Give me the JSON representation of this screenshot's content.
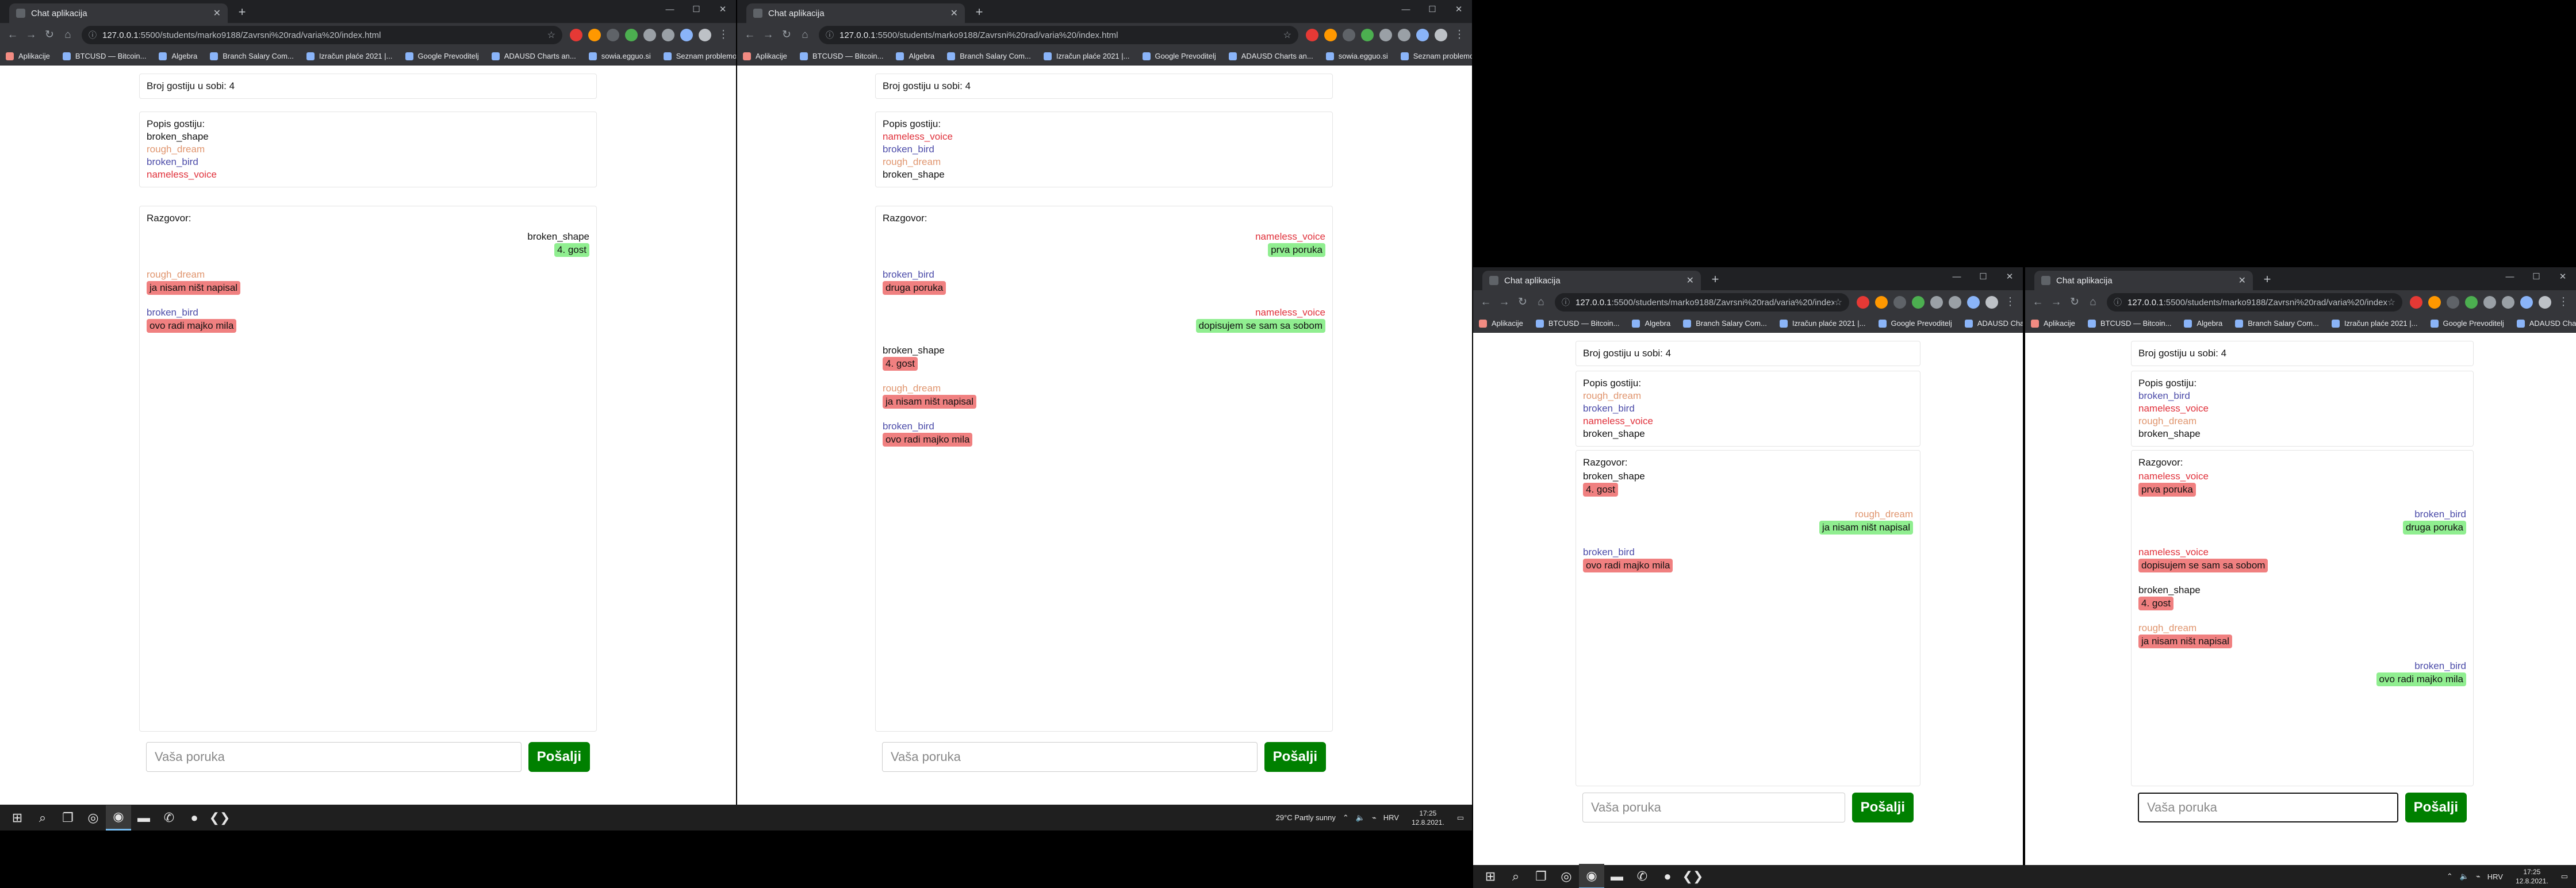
{
  "browser": {
    "tab_title": "Chat aplikacija",
    "url_host": "127.0.0.1",
    "url_rest": ":5500/students/marko9188/Zavrsni%20rad/varia%20/index.html",
    "bookmarks": [
      "Aplikacije",
      "BTCUSD — Bitcoin...",
      "Algebra",
      "Branch Salary Com...",
      "Izračun plaće 2021 |...",
      "Google Prevoditelj",
      "ADAUSD Charts an...",
      "sowia.egguo.si",
      "Seznam problemov..."
    ],
    "bookmarks_short": [
      "Aplikacije",
      "BTCUSD — Bitcoin...",
      "Algebra",
      "Branch Salary Com...",
      "Izračun plaće 2021 |...",
      "Google Prevoditelj",
      "ADAUSD Charts an..."
    ]
  },
  "labels": {
    "guest_count": "Broj gostiju u sobi: 4",
    "guest_list_title": "Popis gostiju:",
    "chat_title": "Razgovor:",
    "input_placeholder": "Vaša poruka",
    "send": "Pošalji"
  },
  "colors": {
    "broken_shape": "#111111",
    "rough_dream": "#e0956e",
    "broken_bird": "#4a4aa8",
    "nameless_voice": "#e0303a",
    "own_bubble": "#90ee90",
    "other_bubble": "#f08080",
    "send_button": "#008000"
  },
  "windows": [
    {
      "id": "w1",
      "guests": [
        {
          "name": "broken_shape",
          "color": "#111111"
        },
        {
          "name": "rough_dream",
          "color": "#e0956e"
        },
        {
          "name": "broken_bird",
          "color": "#4a4aa8"
        },
        {
          "name": "nameless_voice",
          "color": "#e0303a"
        }
      ],
      "messages": [
        {
          "user": "broken_shape",
          "text": "4. gost",
          "own": true,
          "color": "#111111"
        },
        {
          "user": "rough_dream",
          "text": "ja nisam ništ napisal",
          "own": false,
          "color": "#e0956e"
        },
        {
          "user": "broken_bird",
          "text": "ovo radi majko mila",
          "own": false,
          "color": "#4a4aa8"
        }
      ]
    },
    {
      "id": "w2",
      "guests": [
        {
          "name": "nameless_voice",
          "color": "#e0303a"
        },
        {
          "name": "broken_bird",
          "color": "#4a4aa8"
        },
        {
          "name": "rough_dream",
          "color": "#e0956e"
        },
        {
          "name": "broken_shape",
          "color": "#111111"
        }
      ],
      "messages": [
        {
          "user": "nameless_voice",
          "text": "prva poruka",
          "own": true,
          "color": "#e0303a"
        },
        {
          "user": "broken_bird",
          "text": "druga poruka",
          "own": false,
          "color": "#4a4aa8"
        },
        {
          "user": "nameless_voice",
          "text": "dopisujem se sam sa sobom",
          "own": true,
          "color": "#e0303a"
        },
        {
          "user": "broken_shape",
          "text": "4. gost",
          "own": false,
          "color": "#111111"
        },
        {
          "user": "rough_dream",
          "text": "ja nisam ništ napisal",
          "own": false,
          "color": "#e0956e"
        },
        {
          "user": "broken_bird",
          "text": "ovo radi majko mila",
          "own": false,
          "color": "#4a4aa8"
        }
      ]
    },
    {
      "id": "w3",
      "guests": [
        {
          "name": "rough_dream",
          "color": "#e0956e"
        },
        {
          "name": "broken_bird",
          "color": "#4a4aa8"
        },
        {
          "name": "nameless_voice",
          "color": "#e0303a"
        },
        {
          "name": "broken_shape",
          "color": "#111111"
        }
      ],
      "messages": [
        {
          "user": "broken_shape",
          "text": "4. gost",
          "own": false,
          "color": "#111111"
        },
        {
          "user": "rough_dream",
          "text": "ja nisam ništ napisal",
          "own": true,
          "color": "#e0956e"
        },
        {
          "user": "broken_bird",
          "text": "ovo radi majko mila",
          "own": false,
          "color": "#4a4aa8"
        }
      ]
    },
    {
      "id": "w4",
      "guests": [
        {
          "name": "broken_bird",
          "color": "#4a4aa8"
        },
        {
          "name": "nameless_voice",
          "color": "#e0303a"
        },
        {
          "name": "rough_dream",
          "color": "#e0956e"
        },
        {
          "name": "broken_shape",
          "color": "#111111"
        }
      ],
      "messages": [
        {
          "user": "nameless_voice",
          "text": "prva poruka",
          "own": false,
          "color": "#e0303a"
        },
        {
          "user": "broken_bird",
          "text": "druga poruka",
          "own": true,
          "color": "#4a4aa8"
        },
        {
          "user": "nameless_voice",
          "text": "dopisujem se sam sa sobom",
          "own": false,
          "color": "#e0303a"
        },
        {
          "user": "broken_shape",
          "text": "4. gost",
          "own": false,
          "color": "#111111"
        },
        {
          "user": "rough_dream",
          "text": "ja nisam ništ napisal",
          "own": false,
          "color": "#e0956e"
        },
        {
          "user": "broken_bird",
          "text": "ovo radi majko mila",
          "own": true,
          "color": "#4a4aa8"
        }
      ]
    }
  ],
  "taskbar": {
    "weather": "29°C  Partly sunny",
    "lang": "HRV",
    "time": "17:25",
    "date": "12.8.2021."
  }
}
